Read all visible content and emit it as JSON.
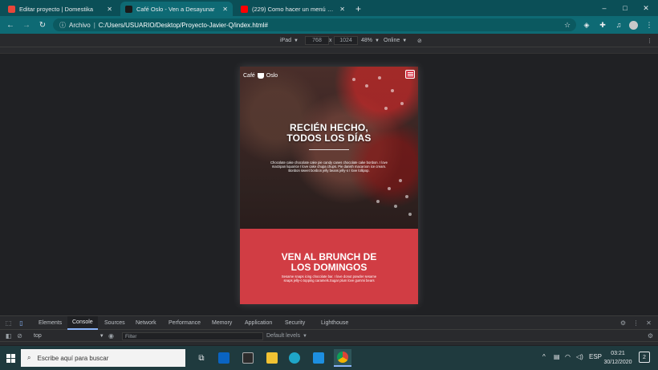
{
  "browser": {
    "tabs": [
      {
        "title": "Editar proyecto | Domestika",
        "favicon_color": "#e8463a"
      },
      {
        "title": "Café Oslo - Ven a Desayunar",
        "favicon_color": "#1a1a1a"
      },
      {
        "title": "(229) Como hacer un menú de n",
        "favicon_color": "#ff0000"
      }
    ],
    "new_tab": "+",
    "window_controls": {
      "minimize": "–",
      "maximize": "□",
      "close": "✕"
    },
    "address": {
      "prefix": "Archivo",
      "separator": "|",
      "url": "C:/Users/USUARIO/Desktop/Proyecto-Javier-Q/index.html#"
    }
  },
  "device_toolbar": {
    "device": "iPad",
    "width": "768",
    "x": "x",
    "height": "1024",
    "zoom": "48%",
    "network": "Online"
  },
  "page": {
    "logo_left": "Café",
    "logo_right": "Oslo",
    "hero_title_line1": "RECIÉN HECHO,",
    "hero_title_line2": "TODOS LOS DÍAS",
    "hero_text": "Chocolate cake chocolate cake pie candy canes chocolate cake bonbon. I love marzipan liquorice I love cake chupa chups. Pie danish macaroon ice cream. Bonbon sweet bonbon jelly beans jelly-o I love lollipop.",
    "brunch_title_line1": "VEN AL BRUNCH DE",
    "brunch_title_line2": "LOS DOMINGOS",
    "brunch_text": "Sesame snaps icing chocolate bar. I love donut powder sesame snaps jelly-o topping caramels.Sugar plum love gummi bears"
  },
  "devtools": {
    "tabs": [
      "Elements",
      "Console",
      "Sources",
      "Network",
      "Performance",
      "Memory",
      "Application",
      "Security",
      "Lighthouse"
    ],
    "active_tab": "Console",
    "context": "top",
    "filter_placeholder": "Filter",
    "levels": "Default levels"
  },
  "taskbar": {
    "search_placeholder": "Escribe aquí para buscar",
    "language": "ESP",
    "time": "03:21",
    "date": "30/12/2020",
    "notifications": "2"
  }
}
